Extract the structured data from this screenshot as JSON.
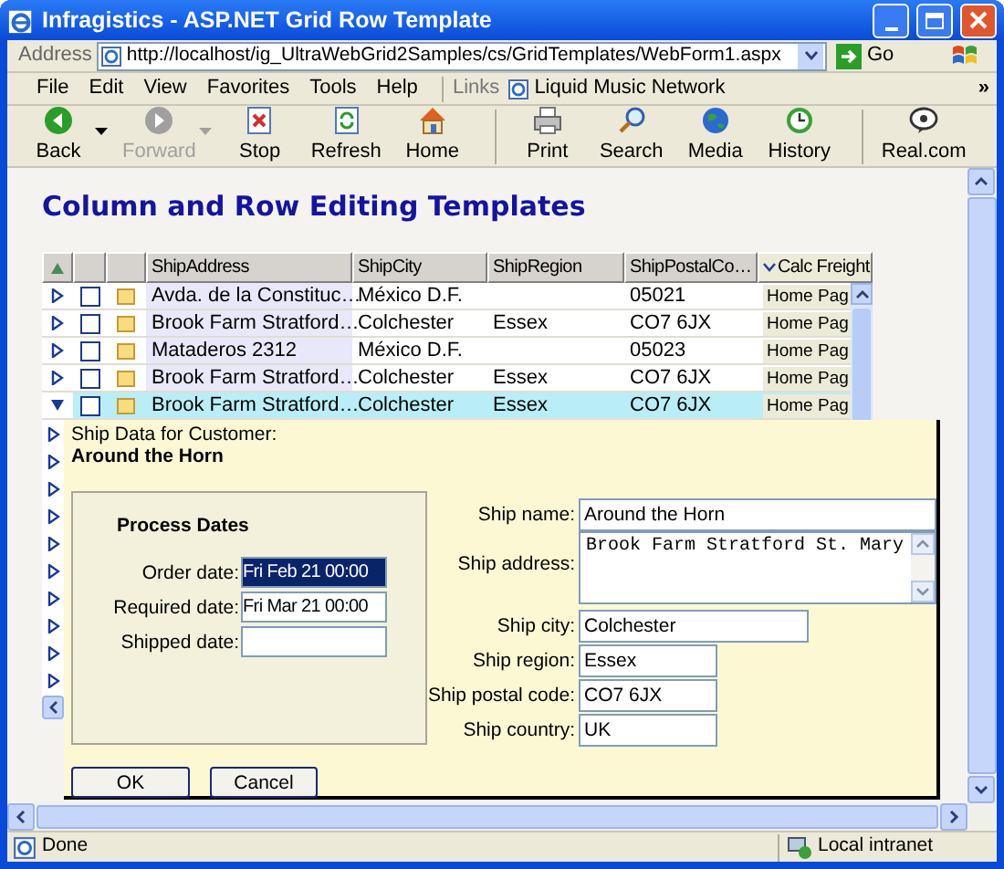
{
  "window": {
    "title": "Infragistics - ASP.NET Grid Row Template"
  },
  "address_bar": {
    "label": "Address",
    "url": "http://localhost/ig_UltraWebGrid2Samples/cs/GridTemplates/WebForm1.aspx",
    "go": "Go"
  },
  "menu": [
    "File",
    "Edit",
    "View",
    "Favorites",
    "Tools",
    "Help"
  ],
  "links": {
    "label": "Links",
    "items": [
      "Liquid Music Network"
    ],
    "more": "»"
  },
  "toolbar": [
    {
      "label": "Back",
      "kind": "back",
      "disabled": false,
      "dropdown": true,
      "separator_after": false
    },
    {
      "label": "Forward",
      "kind": "forward",
      "disabled": true,
      "dropdown": true,
      "separator_after": false
    },
    {
      "label": "Stop",
      "kind": "stop",
      "disabled": false,
      "dropdown": false,
      "separator_after": false
    },
    {
      "label": "Refresh",
      "kind": "refresh",
      "disabled": false,
      "dropdown": false,
      "separator_after": false
    },
    {
      "label": "Home",
      "kind": "home",
      "disabled": false,
      "dropdown": false,
      "separator_after": true
    },
    {
      "label": "Print",
      "kind": "print",
      "disabled": false,
      "dropdown": false,
      "separator_after": false
    },
    {
      "label": "Search",
      "kind": "search",
      "disabled": false,
      "dropdown": false,
      "separator_after": false
    },
    {
      "label": "Media",
      "kind": "media",
      "disabled": false,
      "dropdown": false,
      "separator_after": false
    },
    {
      "label": "History",
      "kind": "history",
      "disabled": false,
      "dropdown": false,
      "separator_after": true
    },
    {
      "label": "Real.com",
      "kind": "real",
      "disabled": false,
      "dropdown": false,
      "separator_after": false
    }
  ],
  "page": {
    "heading": "Column and Row Editing Templates"
  },
  "grid": {
    "columns": [
      {
        "label": "ShipAddress",
        "sorted": false
      },
      {
        "label": "ShipCity",
        "sorted": false
      },
      {
        "label": "ShipRegion",
        "sorted": false
      },
      {
        "label": "ShipPostalCo…",
        "sorted": false
      },
      {
        "label": "Calc Freight",
        "sorted": true
      }
    ],
    "rows": [
      {
        "address": "Avda. de la Constituc…",
        "city": "México D.F.",
        "postal": "05021",
        "calc": "Home Pag",
        "checked": false,
        "selected": false,
        "expanded": false
      },
      {
        "address": "Brook Farm Stratford…",
        "city": "Colchester",
        "region": "Essex",
        "postal": "CO7 6JX",
        "calc": "Home Pag",
        "checked": false,
        "selected": false,
        "expanded": false
      },
      {
        "address": "Mataderos 2312",
        "city": "México D.F.",
        "postal": "05023",
        "calc": "Home Pag",
        "checked": false,
        "selected": false,
        "expanded": false
      },
      {
        "address": "Brook Farm Stratford…",
        "city": "Colchester",
        "region": "Essex",
        "postal": "CO7 6JX",
        "calc": "Home Pag",
        "checked": false,
        "selected": false,
        "expanded": false
      },
      {
        "address": "Brook Farm Stratford…",
        "city": "Colchester",
        "region": "Essex",
        "postal": "CO7 6JX",
        "calc": "Home Pag",
        "checked": false,
        "selected": true,
        "expanded": true
      }
    ],
    "covered_rows": [
      {
        "expanded": false
      },
      {
        "expanded": false
      },
      {
        "expanded": false
      },
      {
        "expanded": false
      },
      {
        "expanded": false
      },
      {
        "expanded": false
      },
      {
        "expanded": false
      },
      {
        "expanded": false
      },
      {
        "expanded": false
      },
      {
        "expanded": false
      }
    ]
  },
  "template": {
    "caption": "Ship Data for Customer:",
    "customer": "Around the Horn",
    "dates": {
      "title": "Process Dates",
      "fields": [
        {
          "label": "Order date:",
          "value": "Fri Feb 21 00:00",
          "selected": true
        },
        {
          "label": "Required date:",
          "value": "Fri Mar 21 00:00",
          "selected": false
        },
        {
          "label": "Shipped date:",
          "selected": false
        }
      ]
    },
    "fields": [
      {
        "label": "Ship name:",
        "value": "Around the Horn",
        "kind": "wide"
      },
      {
        "label": "Ship address:",
        "value": "Brook Farm Stratford St. Mary",
        "kind": "multiline"
      },
      {
        "label": "Ship city:",
        "value": "Colchester",
        "kind": "medium"
      },
      {
        "label": "Ship region:",
        "value": "Essex",
        "kind": "short"
      },
      {
        "label": "Ship postal code:",
        "value": "CO7 6JX",
        "kind": "short"
      },
      {
        "label": "Ship country:",
        "value": "UK",
        "kind": "short"
      }
    ],
    "buttons": [
      "OK",
      "Cancel"
    ]
  },
  "status_bar": {
    "text": "Done",
    "zone": "Local intranet"
  }
}
